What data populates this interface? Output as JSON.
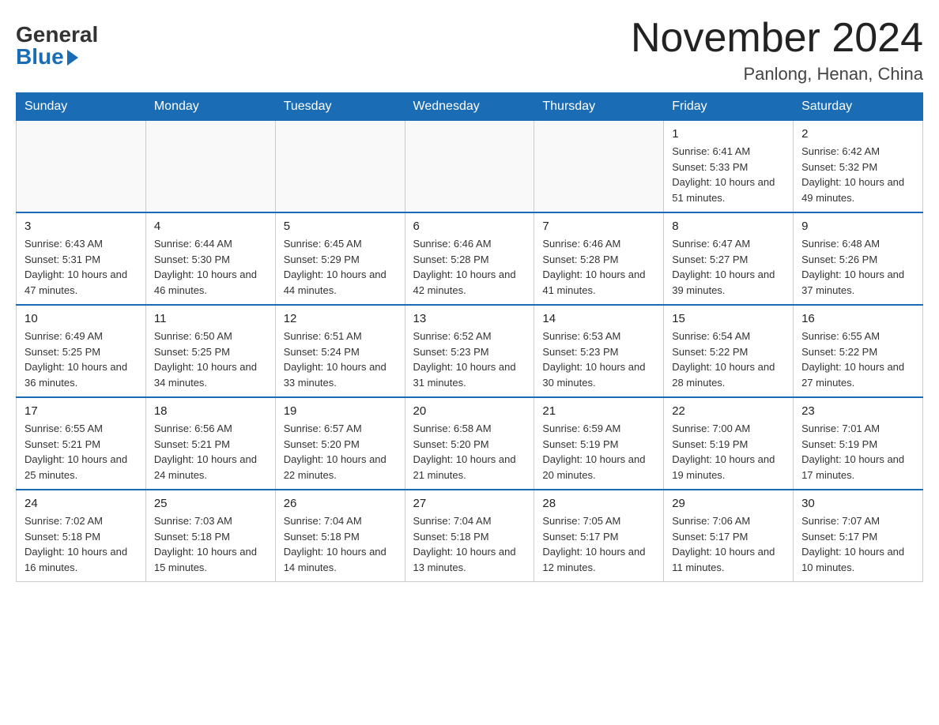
{
  "header": {
    "logo_general": "General",
    "logo_blue": "Blue",
    "title": "November 2024",
    "location": "Panlong, Henan, China"
  },
  "days_of_week": [
    "Sunday",
    "Monday",
    "Tuesday",
    "Wednesday",
    "Thursday",
    "Friday",
    "Saturday"
  ],
  "weeks": [
    [
      {
        "day": "",
        "info": ""
      },
      {
        "day": "",
        "info": ""
      },
      {
        "day": "",
        "info": ""
      },
      {
        "day": "",
        "info": ""
      },
      {
        "day": "",
        "info": ""
      },
      {
        "day": "1",
        "info": "Sunrise: 6:41 AM\nSunset: 5:33 PM\nDaylight: 10 hours and 51 minutes."
      },
      {
        "day": "2",
        "info": "Sunrise: 6:42 AM\nSunset: 5:32 PM\nDaylight: 10 hours and 49 minutes."
      }
    ],
    [
      {
        "day": "3",
        "info": "Sunrise: 6:43 AM\nSunset: 5:31 PM\nDaylight: 10 hours and 47 minutes."
      },
      {
        "day": "4",
        "info": "Sunrise: 6:44 AM\nSunset: 5:30 PM\nDaylight: 10 hours and 46 minutes."
      },
      {
        "day": "5",
        "info": "Sunrise: 6:45 AM\nSunset: 5:29 PM\nDaylight: 10 hours and 44 minutes."
      },
      {
        "day": "6",
        "info": "Sunrise: 6:46 AM\nSunset: 5:28 PM\nDaylight: 10 hours and 42 minutes."
      },
      {
        "day": "7",
        "info": "Sunrise: 6:46 AM\nSunset: 5:28 PM\nDaylight: 10 hours and 41 minutes."
      },
      {
        "day": "8",
        "info": "Sunrise: 6:47 AM\nSunset: 5:27 PM\nDaylight: 10 hours and 39 minutes."
      },
      {
        "day": "9",
        "info": "Sunrise: 6:48 AM\nSunset: 5:26 PM\nDaylight: 10 hours and 37 minutes."
      }
    ],
    [
      {
        "day": "10",
        "info": "Sunrise: 6:49 AM\nSunset: 5:25 PM\nDaylight: 10 hours and 36 minutes."
      },
      {
        "day": "11",
        "info": "Sunrise: 6:50 AM\nSunset: 5:25 PM\nDaylight: 10 hours and 34 minutes."
      },
      {
        "day": "12",
        "info": "Sunrise: 6:51 AM\nSunset: 5:24 PM\nDaylight: 10 hours and 33 minutes."
      },
      {
        "day": "13",
        "info": "Sunrise: 6:52 AM\nSunset: 5:23 PM\nDaylight: 10 hours and 31 minutes."
      },
      {
        "day": "14",
        "info": "Sunrise: 6:53 AM\nSunset: 5:23 PM\nDaylight: 10 hours and 30 minutes."
      },
      {
        "day": "15",
        "info": "Sunrise: 6:54 AM\nSunset: 5:22 PM\nDaylight: 10 hours and 28 minutes."
      },
      {
        "day": "16",
        "info": "Sunrise: 6:55 AM\nSunset: 5:22 PM\nDaylight: 10 hours and 27 minutes."
      }
    ],
    [
      {
        "day": "17",
        "info": "Sunrise: 6:55 AM\nSunset: 5:21 PM\nDaylight: 10 hours and 25 minutes."
      },
      {
        "day": "18",
        "info": "Sunrise: 6:56 AM\nSunset: 5:21 PM\nDaylight: 10 hours and 24 minutes."
      },
      {
        "day": "19",
        "info": "Sunrise: 6:57 AM\nSunset: 5:20 PM\nDaylight: 10 hours and 22 minutes."
      },
      {
        "day": "20",
        "info": "Sunrise: 6:58 AM\nSunset: 5:20 PM\nDaylight: 10 hours and 21 minutes."
      },
      {
        "day": "21",
        "info": "Sunrise: 6:59 AM\nSunset: 5:19 PM\nDaylight: 10 hours and 20 minutes."
      },
      {
        "day": "22",
        "info": "Sunrise: 7:00 AM\nSunset: 5:19 PM\nDaylight: 10 hours and 19 minutes."
      },
      {
        "day": "23",
        "info": "Sunrise: 7:01 AM\nSunset: 5:19 PM\nDaylight: 10 hours and 17 minutes."
      }
    ],
    [
      {
        "day": "24",
        "info": "Sunrise: 7:02 AM\nSunset: 5:18 PM\nDaylight: 10 hours and 16 minutes."
      },
      {
        "day": "25",
        "info": "Sunrise: 7:03 AM\nSunset: 5:18 PM\nDaylight: 10 hours and 15 minutes."
      },
      {
        "day": "26",
        "info": "Sunrise: 7:04 AM\nSunset: 5:18 PM\nDaylight: 10 hours and 14 minutes."
      },
      {
        "day": "27",
        "info": "Sunrise: 7:04 AM\nSunset: 5:18 PM\nDaylight: 10 hours and 13 minutes."
      },
      {
        "day": "28",
        "info": "Sunrise: 7:05 AM\nSunset: 5:17 PM\nDaylight: 10 hours and 12 minutes."
      },
      {
        "day": "29",
        "info": "Sunrise: 7:06 AM\nSunset: 5:17 PM\nDaylight: 10 hours and 11 minutes."
      },
      {
        "day": "30",
        "info": "Sunrise: 7:07 AM\nSunset: 5:17 PM\nDaylight: 10 hours and 10 minutes."
      }
    ]
  ]
}
